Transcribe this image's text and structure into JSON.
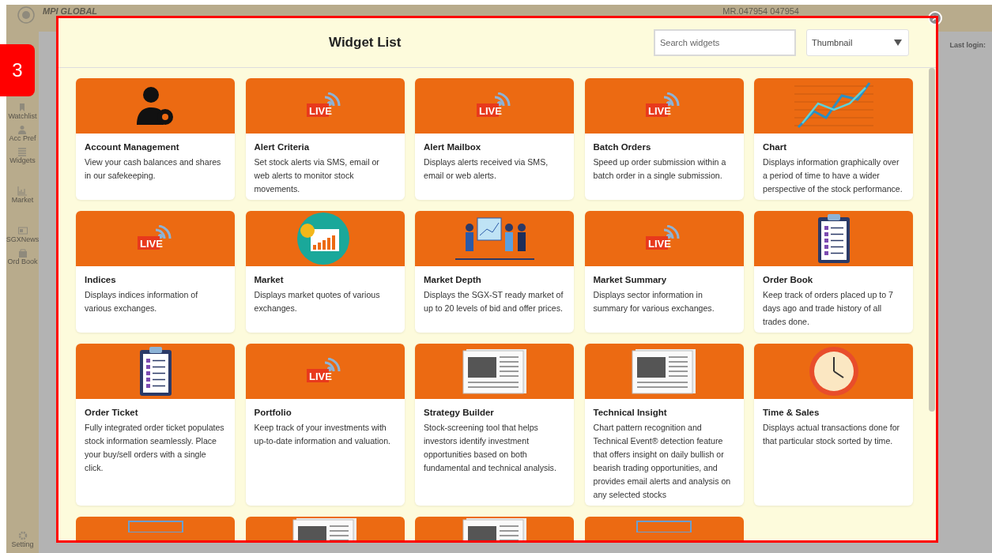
{
  "app": {
    "logo_text": "MPI GLOBAL",
    "account": "MR.047954 047954",
    "last_login_label": "Last login:",
    "sidebar": [
      {
        "label": "Watchlist",
        "kind": "bookmark"
      },
      {
        "label": "Acc Pref",
        "kind": "user"
      },
      {
        "label": "Widgets",
        "kind": "list"
      },
      {
        "label": "Market",
        "kind": "bars"
      },
      {
        "label": "SGXNews",
        "kind": "news"
      },
      {
        "label": "Ord Book",
        "kind": "bag"
      }
    ],
    "setting_label": "Setting"
  },
  "annotation": {
    "label": "3"
  },
  "modal": {
    "title": "Widget List",
    "search": {
      "placeholder": "Search widgets"
    },
    "view_select": {
      "value": "Thumbnail"
    },
    "widgets": [
      {
        "name": "Account Management",
        "description": "View your cash balances and shares in our safekeeping.",
        "kind": "person-gear"
      },
      {
        "name": "Alert Criteria",
        "description": "Set stock alerts via SMS, email or web alerts to monitor stock movements.",
        "kind": "live",
        "image_text": "LIVE"
      },
      {
        "name": "Alert Mailbox",
        "description": "Displays alerts received via SMS, email or web alerts.",
        "kind": "live",
        "image_text": "LIVE"
      },
      {
        "name": "Batch Orders",
        "description": "Speed up order submission within a batch order in a single submission.",
        "kind": "live",
        "image_text": "LIVE"
      },
      {
        "name": "Chart",
        "description": "Displays information graphically over a period of time to have a wider perspective of the stock performance.",
        "kind": "chart"
      },
      {
        "name": "Indices",
        "description": "Displays indices information of various exchanges.",
        "kind": "live",
        "image_text": "LIVE"
      },
      {
        "name": "Market",
        "description": "Displays market quotes of various exchanges.",
        "kind": "market"
      },
      {
        "name": "Market Depth",
        "description": "Displays the SGX-ST ready market of up to 20 levels of bid and offer prices.",
        "kind": "presentation"
      },
      {
        "name": "Market Summary",
        "description": "Displays sector information in summary for various exchanges.",
        "kind": "live",
        "image_text": "LIVE"
      },
      {
        "name": "Order Book",
        "description": "Keep track of orders placed up to 7 days ago and trade history of all trades done.",
        "kind": "clipboard"
      },
      {
        "name": "Order Ticket",
        "description": "Fully integrated order ticket populates stock information seamlessly. Place your buy/sell orders with a single click.",
        "kind": "clipboard"
      },
      {
        "name": "Portfolio",
        "description": "Keep track of your investments with up-to-date information and valuation.",
        "kind": "live",
        "image_text": "LIVE"
      },
      {
        "name": "Strategy Builder",
        "description": "Stock-screening tool that helps investors identify investment opportunities based on both fundamental and technical analysis.",
        "kind": "newspaper"
      },
      {
        "name": "Technical Insight",
        "description": "Chart pattern recognition and Technical Event® detection feature that offers insight on daily bullish or bearish trading opportunities, and provides email alerts and analysis on any selected stocks",
        "kind": "newspaper"
      },
      {
        "name": "Time & Sales",
        "description": "Displays actual transactions done for that particular stock sorted by time.",
        "kind": "clock"
      }
    ],
    "partial_widgets": [
      {
        "kind": "frame"
      },
      {
        "kind": "newspaper"
      },
      {
        "kind": "newspaper"
      },
      {
        "kind": "frame"
      }
    ]
  }
}
